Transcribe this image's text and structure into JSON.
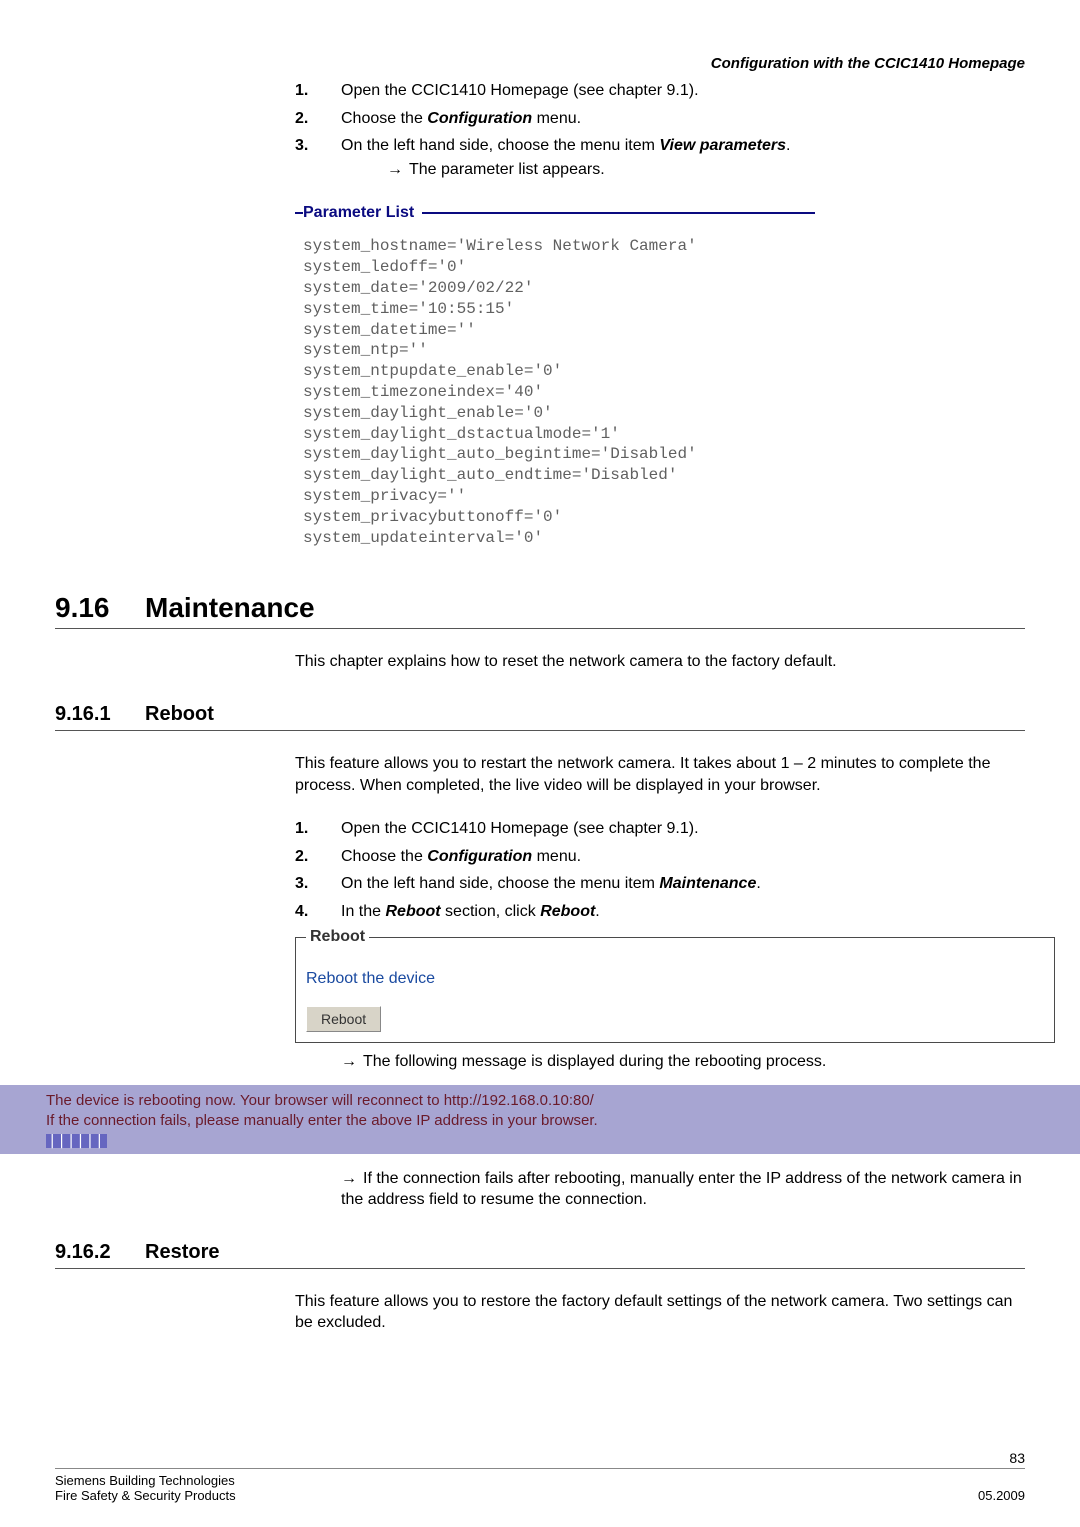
{
  "header": {
    "right": "Configuration with the CCIC1410 Homepage"
  },
  "intro_steps": [
    {
      "num": "1.",
      "text": "Open the CCIC1410 Homepage (see chapter 9.1)."
    },
    {
      "num": "2.",
      "text_pre": "Choose the ",
      "bold": "Configuration",
      "text_post": " menu."
    },
    {
      "num": "3.",
      "text_pre": "On the left hand side, choose the menu item ",
      "bold": "View parameters",
      "text_post": "."
    }
  ],
  "intro_arrow": "The parameter list appears.",
  "param_list": {
    "legend": "Parameter List",
    "lines": "system_hostname='Wireless Network Camera'\nsystem_ledoff='0'\nsystem_date='2009/02/22'\nsystem_time='10:55:15'\nsystem_datetime=''\nsystem_ntp=''\nsystem_ntpupdate_enable='0'\nsystem_timezoneindex='40'\nsystem_daylight_enable='0'\nsystem_daylight_dstactualmode='1'\nsystem_daylight_auto_begintime='Disabled'\nsystem_daylight_auto_endtime='Disabled'\nsystem_privacy=''\nsystem_privacybuttonoff='0'\nsystem_updateinterval='0'"
  },
  "maintenance": {
    "num": "9.16",
    "title": "Maintenance",
    "intro": "This chapter explains how to reset the network camera to the factory default."
  },
  "reboot": {
    "num": "9.16.1",
    "title": "Reboot",
    "intro": "This feature allows you to restart the network camera. It takes about 1 – 2 minutes to complete the process. When completed, the live video will be displayed in your browser.",
    "steps": [
      {
        "num": "1.",
        "text": "Open the CCIC1410 Homepage (see chapter 9.1)."
      },
      {
        "num": "2.",
        "text_pre": "Choose the ",
        "bold": "Configuration",
        "text_post": " menu."
      },
      {
        "num": "3.",
        "text_pre": "On the left hand side, choose the menu item ",
        "bold": "Maintenance",
        "text_post": "."
      },
      {
        "num": "4.",
        "text_pre": "In the ",
        "bold": "Reboot",
        "text_mid": " section, click ",
        "bold2": "Reboot",
        "text_post": "."
      }
    ],
    "box": {
      "legend": "Reboot",
      "text": "Reboot the device",
      "button": "Reboot"
    },
    "arrow1": "The following message is displayed during the rebooting process.",
    "msg_line1": "The device is rebooting now. Your browser will reconnect to http://192.168.0.10:80/",
    "msg_line2": "If the connection fails, please manually enter the above IP address in your browser.",
    "progress_stripes": "||||||",
    "arrow2": "If the connection fails after rebooting, manually enter the IP address of the network camera in the address field to resume the connection."
  },
  "restore": {
    "num": "9.16.2",
    "title": "Restore",
    "intro": "This feature allows you to restore the factory default settings of the network camera. Two settings can be excluded."
  },
  "footer": {
    "page": "83",
    "left1": "Siemens Building Technologies",
    "left2": "Fire Safety & Security Products",
    "right2": "05.2009"
  }
}
